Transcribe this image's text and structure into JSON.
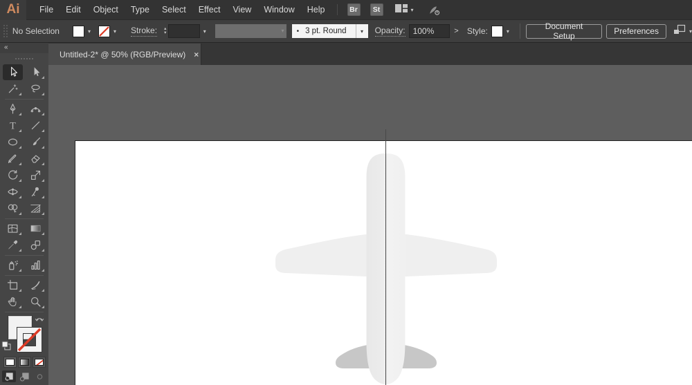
{
  "menu": {
    "logo": "Ai",
    "items": [
      "File",
      "Edit",
      "Object",
      "Type",
      "Select",
      "Effect",
      "View",
      "Window",
      "Help"
    ],
    "bridge_button": "Br",
    "stock_button": "St",
    "workspace_icon": "workspace-switcher-icon",
    "gpu_icon": "gpu-performance-icon"
  },
  "control_bar": {
    "selection_status": "No Selection",
    "stroke_label": "Stroke:",
    "profile_dot": "•",
    "brush_definition": "3 pt. Round",
    "opacity_label": "Opacity:",
    "opacity_value": "100%",
    "more_options_button": ">",
    "style_label": "Style:",
    "document_setup_button": "Document Setup",
    "preferences_button": "Preferences",
    "fill_color": "#ffffff",
    "stroke_color": "none"
  },
  "document_tab": {
    "title": "Untitled-2* @ 50% (RGB/Preview)",
    "close_glyph": "×"
  },
  "tool_panel": {
    "collapse_glyph": "«",
    "type_tool_letter": "T",
    "tools": [
      {
        "id": "selection",
        "active": true
      },
      {
        "id": "direct-selection"
      },
      {
        "id": "magic-wand"
      },
      {
        "id": "lasso"
      },
      {
        "sep": true
      },
      {
        "id": "pen"
      },
      {
        "id": "curvature"
      },
      {
        "id": "type"
      },
      {
        "id": "line-segment"
      },
      {
        "id": "ellipse"
      },
      {
        "id": "paintbrush"
      },
      {
        "id": "shaper"
      },
      {
        "id": "eraser"
      },
      {
        "id": "rotate"
      },
      {
        "id": "scale"
      },
      {
        "id": "width"
      },
      {
        "id": "puppet-warp"
      },
      {
        "id": "shape-builder"
      },
      {
        "id": "perspective-grid"
      },
      {
        "sep": true
      },
      {
        "id": "mesh"
      },
      {
        "id": "gradient"
      },
      {
        "id": "eyedropper"
      },
      {
        "id": "blend"
      },
      {
        "sep": true
      },
      {
        "id": "symbol-sprayer"
      },
      {
        "id": "column-graph"
      },
      {
        "sep": true
      },
      {
        "id": "artboard"
      },
      {
        "id": "slice"
      },
      {
        "id": "hand"
      },
      {
        "id": "zoom"
      },
      {
        "sep": true
      }
    ],
    "swatch_buttons": [
      "color",
      "gradient",
      "none"
    ],
    "drawing_modes": [
      "draw-normal",
      "draw-behind",
      "draw-inside"
    ],
    "active_drawing_mode": "draw-normal"
  },
  "canvas": {
    "artwork": {
      "description": "airplane top view",
      "fuselage_color": "#efefef",
      "wing_color": "#efefef",
      "tail_color": "#c7c7c7",
      "centerline_color": "#484848"
    },
    "artboard_color": "#ffffff",
    "pasteboard_color": "#5e5e5e"
  },
  "colors": {
    "logo_accent": "#cf8a5f",
    "none_slash_red": "#dd3a25",
    "ui_dark": "#333333"
  }
}
